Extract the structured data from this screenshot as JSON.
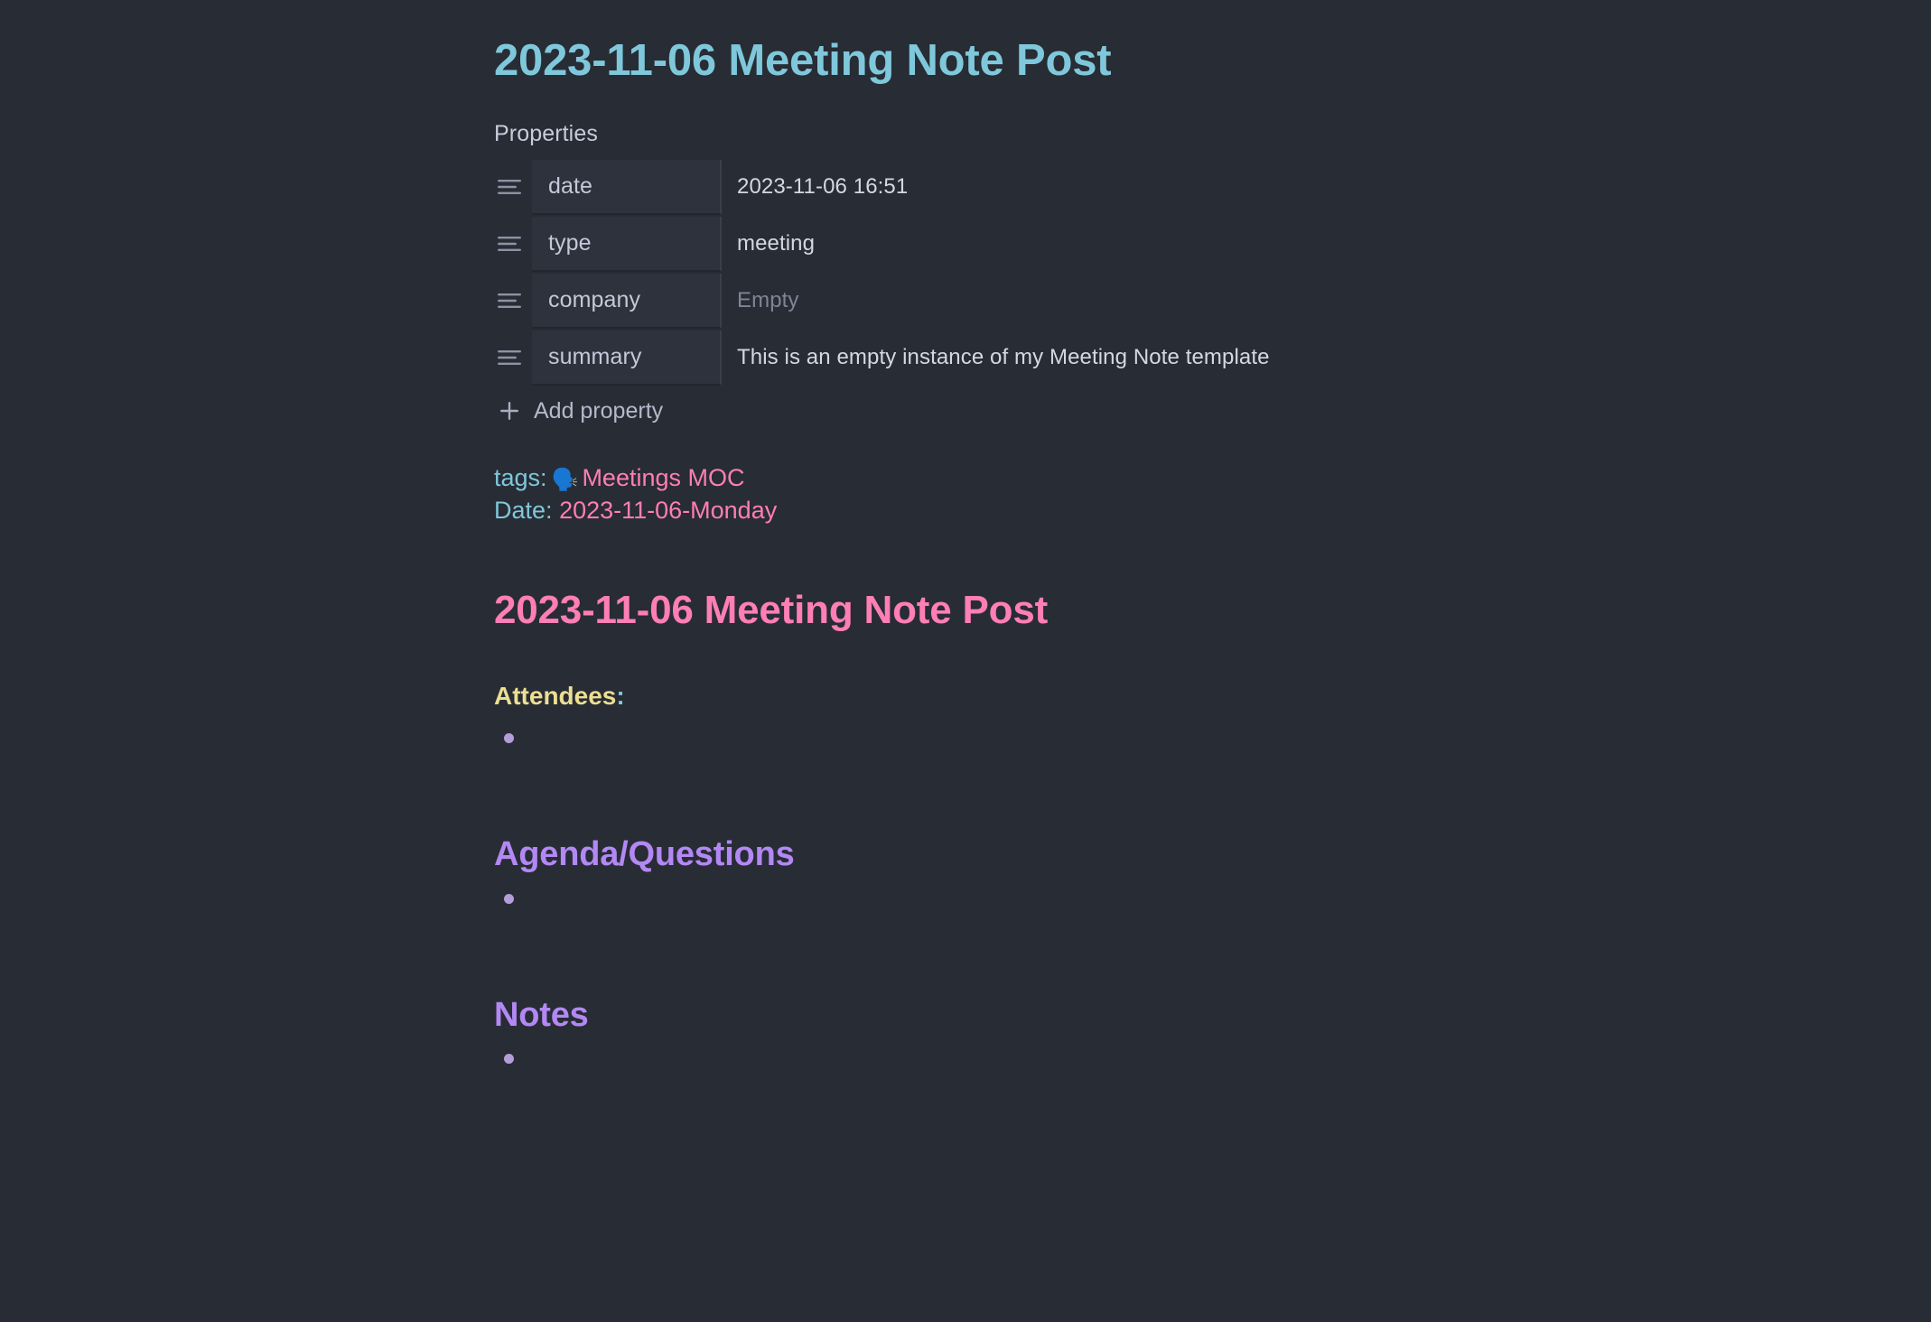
{
  "note": {
    "inline_title": "2023-11-06 Meeting Note Post"
  },
  "properties": {
    "label": "Properties",
    "add_label": "Add property",
    "add_icon": "plus-icon",
    "drag_icon": "text-lines-icon",
    "rows": [
      {
        "key": "date",
        "value": "2023-11-06 16:51",
        "is_empty": false
      },
      {
        "key": "type",
        "value": "meeting",
        "is_empty": false
      },
      {
        "key": "company",
        "value": "Empty",
        "is_empty": true
      },
      {
        "key": "summary",
        "value": "This is an empty instance of my Meeting Note template",
        "is_empty": false
      }
    ]
  },
  "meta": {
    "tags_key": "tags:",
    "tags_emoji": "🗣️",
    "tags_value": "Meetings MOC",
    "date_key": "Date:",
    "date_value": "2023-11-06-Monday"
  },
  "body": {
    "heading_title": "2023-11-06 Meeting Note Post",
    "attendees_label": "Attendees",
    "attendees_colon": ":",
    "attendees_items": [
      ""
    ],
    "agenda_heading": "Agenda/Questions",
    "agenda_items": [
      ""
    ],
    "notes_heading": "Notes",
    "notes_items": [
      ""
    ]
  },
  "colors": {
    "background": "#282c34",
    "title_cyan": "#7fc8db",
    "heading_pink": "#ff7eb6",
    "heading_purple": "#b388f5",
    "attendees_yellow": "#ecdf93",
    "bullet_purple": "#b39ddb",
    "body_text": "#d3d8e4",
    "muted_text": "#7d8596",
    "prop_field_bg": "#2e323c"
  }
}
